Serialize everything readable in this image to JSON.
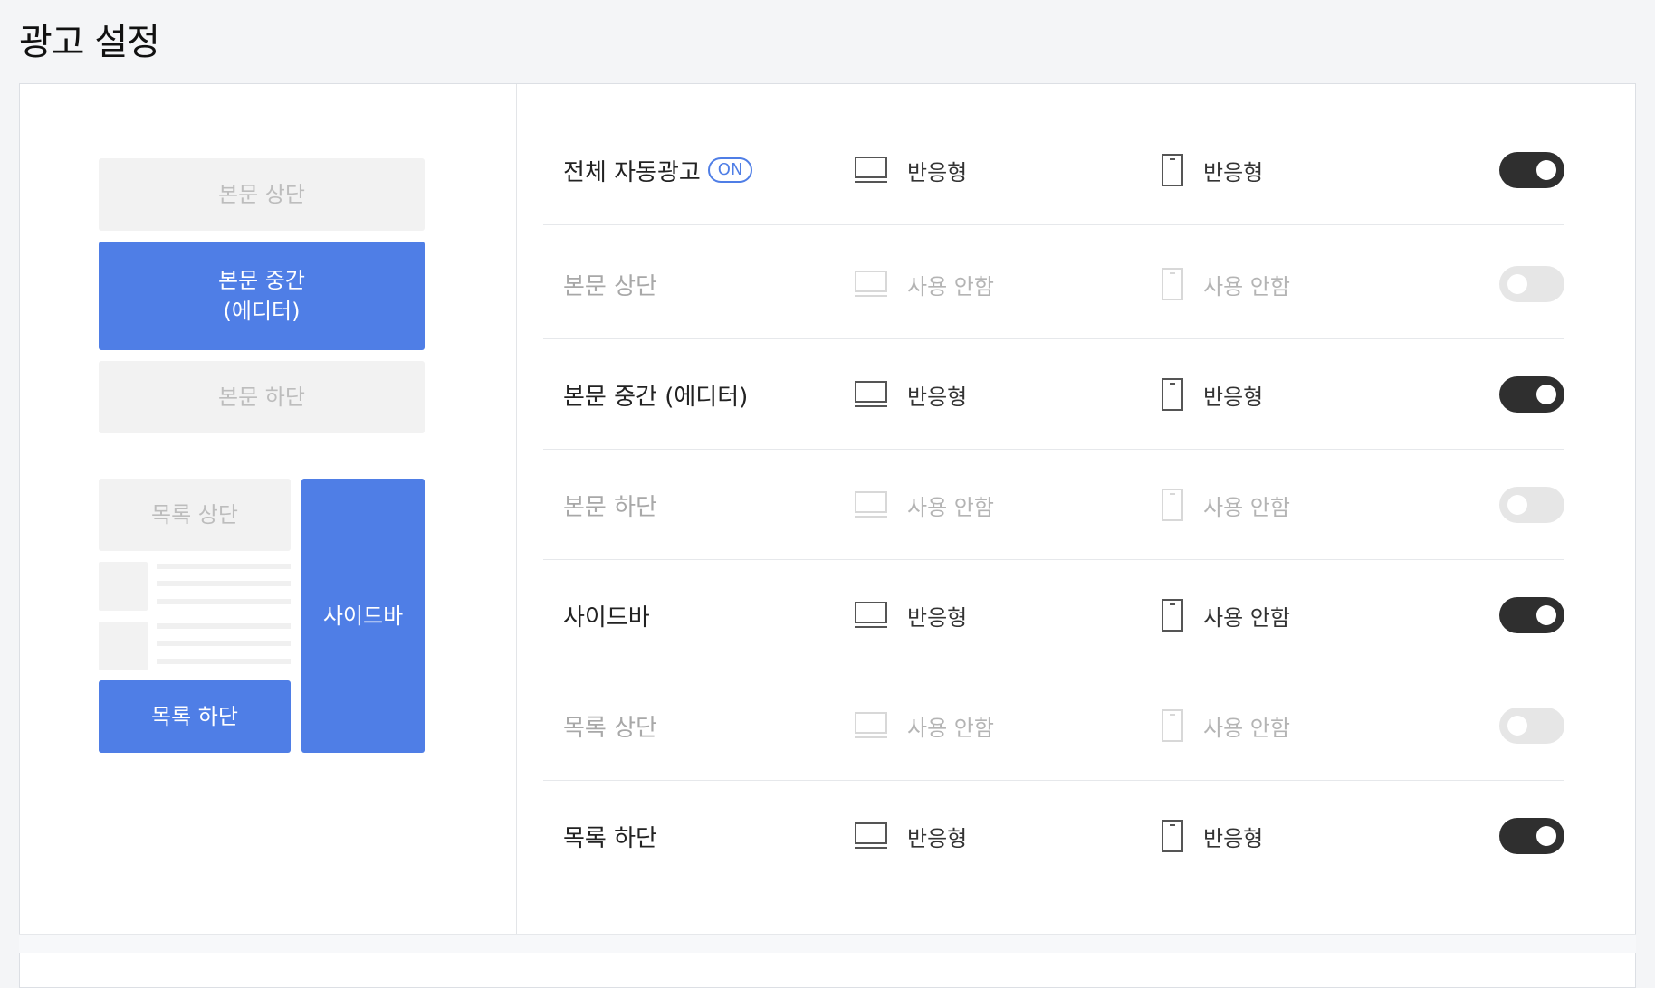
{
  "page": {
    "title": "광고 설정"
  },
  "preview": {
    "body_top": "본문 상단",
    "body_mid_line1": "본문 중간",
    "body_mid_line2": "(에디터)",
    "body_bottom": "본문 하단",
    "list_top": "목록 상단",
    "list_bottom": "목록 하단",
    "sidebar": "사이드바"
  },
  "rows": [
    {
      "label": "전체 자동광고",
      "badge": "ON",
      "desktop": "반응형",
      "mobile": "반응형",
      "enabled": true
    },
    {
      "label": "본문 상단",
      "desktop": "사용 안함",
      "mobile": "사용 안함",
      "enabled": false
    },
    {
      "label": "본문 중간 (에디터)",
      "desktop": "반응형",
      "mobile": "반응형",
      "enabled": true
    },
    {
      "label": "본문 하단",
      "desktop": "사용 안함",
      "mobile": "사용 안함",
      "enabled": false
    },
    {
      "label": "사이드바",
      "desktop": "반응형",
      "mobile": "사용 안함",
      "enabled": true
    },
    {
      "label": "목록 상단",
      "desktop": "사용 안함",
      "mobile": "사용 안함",
      "enabled": false
    },
    {
      "label": "목록 하단",
      "desktop": "반응형",
      "mobile": "반응형",
      "enabled": true
    }
  ],
  "icons": {
    "desktop": "desktop-icon",
    "mobile": "mobile-icon"
  },
  "colors": {
    "accent": "#4f7ee6",
    "toggle_on": "#2f2f2f",
    "toggle_off": "#e6e6e6"
  }
}
